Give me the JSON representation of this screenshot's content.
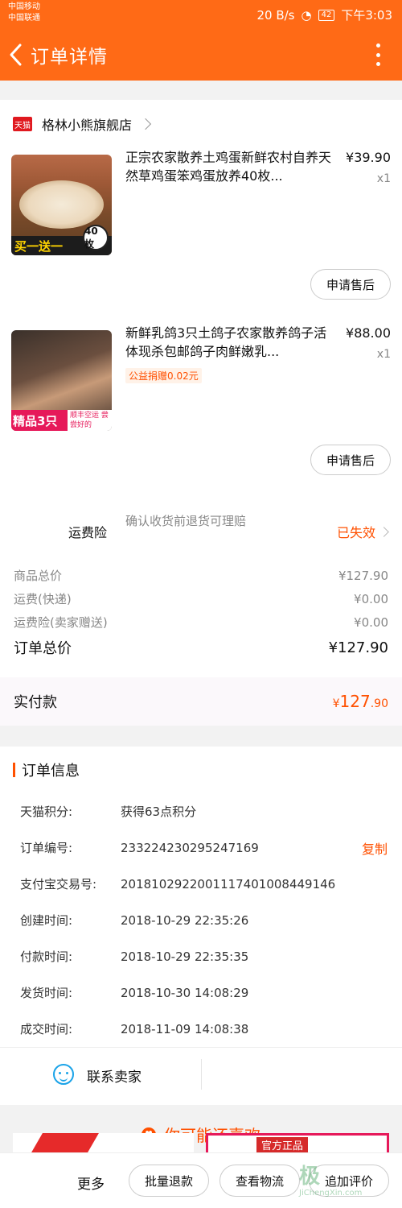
{
  "status_bar": {
    "carrier1": "中国移动",
    "carrier2": "中国联通",
    "speed": "20 B/s",
    "battery": "42",
    "time": "下午3:03"
  },
  "header": {
    "title": "订单详情"
  },
  "store": {
    "badge": "天猫",
    "name": "格林小熊旗舰店"
  },
  "items": [
    {
      "name": "正宗农家散养土鸡蛋新鲜农村自养天然草鸡蛋笨鸡蛋放养40枚...",
      "price": "¥39.90",
      "qty": "x1",
      "thumb_tag": "买一送一",
      "thumb_badge": "40枚",
      "after_sale": "申请售后"
    },
    {
      "name": "新鲜乳鸽3只土鸽子农家散养鸽子活体现杀包邮鸽子肉鲜嫩乳...",
      "price": "¥88.00",
      "qty": "x1",
      "charity": "公益捐赠0.02元",
      "thumb_tag": "精品3只",
      "thumb_sub": "顺丰空运 尝尝好的",
      "after_sale": "申请售后"
    }
  ],
  "insurance": {
    "label": "运费险",
    "desc": "确认收货前退货可理赔",
    "state": "已失效"
  },
  "totals": [
    {
      "label": "商品总价",
      "value": "¥127.90"
    },
    {
      "label": "运费(快递)",
      "value": "¥0.00"
    },
    {
      "label": "运费险(卖家赠送)",
      "value": "¥0.00"
    }
  ],
  "order_total": {
    "label": "订单总价",
    "value": "¥127.90"
  },
  "paid": {
    "label": "实付款",
    "currency": "¥",
    "int": "127",
    "dec": ".90"
  },
  "order_info": {
    "title": "订单信息",
    "rows": [
      {
        "k": "天猫积分:",
        "v": "获得63点积分"
      },
      {
        "k": "订单编号:",
        "v": "233224230295247169",
        "action": "复制"
      },
      {
        "k": "支付宝交易号:",
        "v": "2018102922001117401008449146"
      },
      {
        "k": "创建时间:",
        "v": "2018-10-29 22:35:26"
      },
      {
        "k": "付款时间:",
        "v": "2018-10-29 22:35:35"
      },
      {
        "k": "发货时间:",
        "v": "2018-10-30 14:08:29"
      },
      {
        "k": "成交时间:",
        "v": "2018-11-09 14:08:38"
      }
    ]
  },
  "contact": {
    "label": "联系卖家"
  },
  "recommend": {
    "title": "你可能还喜欢",
    "promo_tag": "官方正品"
  },
  "bottom_bar": {
    "more": "更多",
    "refund": "批量退款",
    "logistics": "查看物流",
    "review": "追加评价"
  },
  "watermark": {
    "main": "极",
    "site": "JiChengXin.com"
  },
  "colors": {
    "accent": "#ff6a16",
    "price_red": "#ff5000",
    "tmall_red": "#e0191f"
  }
}
